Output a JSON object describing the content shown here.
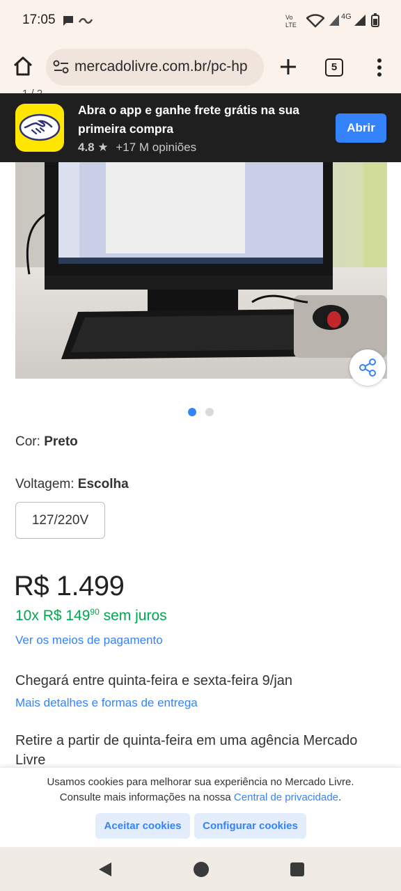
{
  "status_bar": {
    "time": "17:05",
    "network": "4G"
  },
  "browser": {
    "url": "mercadolivre.com.br/pc-hp",
    "tab_count": "5"
  },
  "app_banner": {
    "text": "Abra o app e ganhe frete grátis na sua primeira compra",
    "rating": "4.8",
    "reviews": "+17 M opiniões",
    "open_label": "Abrir",
    "colors": {
      "logo_bg": "#ffe600",
      "button_bg": "#3483fa"
    }
  },
  "gallery": {
    "image_counter": "1 / 2",
    "total_images": 2,
    "active_index": 0
  },
  "product": {
    "color_label": "Cor: ",
    "color_value": "Preto",
    "voltage_label": "Voltagem: ",
    "voltage_value": "Escolha",
    "voltage_option": "127/220V",
    "price": "R$ 1.499",
    "installments_prefix": "10x R$ 149",
    "installments_cents": "90",
    "installments_suffix": " sem juros",
    "payment_link": "Ver os meios de pagamento",
    "delivery_text": "Chegará entre quinta-feira e sexta-feira 9/jan",
    "delivery_link": "Mais detalhes e formas de entrega",
    "pickup_line1": "Retire a partir de quinta-feira em uma agência Mercado",
    "pickup_line2": "Livre"
  },
  "cookies": {
    "line1": "Usamos cookies para melhorar sua experiência no Mercado Livre.",
    "line2_prefix": "Consulte mais informações na nossa ",
    "line2_link": "Central de privacidade",
    "line2_suffix": ".",
    "accept_label": "Aceitar cookies",
    "configure_label": "Configurar cookies"
  },
  "colors": {
    "accent_blue": "#3483fa",
    "green": "#00a650",
    "browser_bg": "#fbf2ec"
  }
}
